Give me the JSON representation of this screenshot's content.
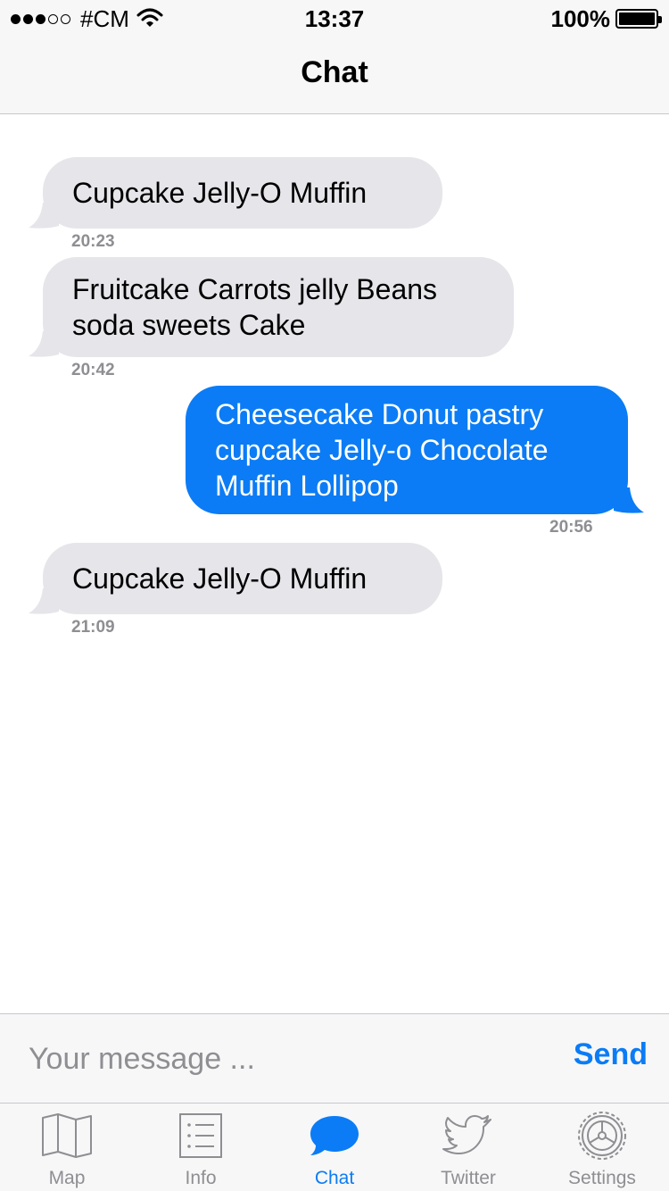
{
  "status_bar": {
    "carrier": "#CM",
    "time": "13:37",
    "battery": "100%"
  },
  "nav": {
    "title": "Chat"
  },
  "messages": [
    {
      "direction": "incoming",
      "text": "Cupcake Jelly-O Muffin",
      "time": "20:23"
    },
    {
      "direction": "incoming",
      "text": "Fruitcake Carrots jelly Beans soda sweets Cake",
      "time": "20:42"
    },
    {
      "direction": "outgoing",
      "text": "Cheesecake Donut pastry cupcake Jelly-o Chocolate Muffin Lollipop",
      "time": "20:56"
    },
    {
      "direction": "incoming",
      "text": "Cupcake Jelly-O Muffin",
      "time": "21:09"
    }
  ],
  "composer": {
    "placeholder": "Your message ...",
    "send_label": "Send"
  },
  "tabs": [
    {
      "label": "Map",
      "icon": "map-icon"
    },
    {
      "label": "Info",
      "icon": "list-icon"
    },
    {
      "label": "Chat",
      "icon": "chat-bubble-icon",
      "active": true
    },
    {
      "label": "Twitter",
      "icon": "twitter-bird-icon"
    },
    {
      "label": "Settings",
      "icon": "gear-icon"
    }
  ],
  "colors": {
    "accent": "#0b7cf5",
    "incoming_bubble": "#e5e5ea",
    "inactive": "#8e8e93"
  }
}
